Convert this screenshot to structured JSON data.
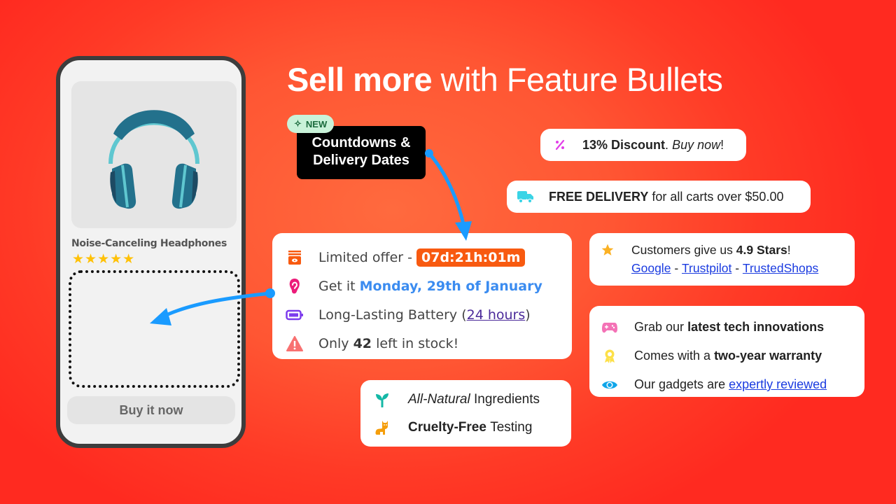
{
  "headline": {
    "bold": "Sell more",
    "light": "with Feature Bullets"
  },
  "phone": {
    "product_title": "Noise-Canceling Headphones",
    "rating_stars": 5,
    "stars_text": "★★★★★",
    "buy_button": "Buy it now",
    "image_icon": "headphones-icon"
  },
  "promo": {
    "badge_label": "NEW",
    "badge_icon": "sparkle-icon",
    "title_line1": "Countdowns &",
    "title_line2": "Delivery Dates"
  },
  "discount_card": {
    "icon": "percent-icon",
    "bold": "13% Discount",
    "sep": ".",
    "italic": "Buy now",
    "end": "!"
  },
  "delivery_card": {
    "icon": "truck-icon",
    "bold": "FREE DELIVERY",
    "rest": "for all carts over $50.00"
  },
  "main_card": {
    "items": [
      {
        "icon": "gift-box-icon",
        "text": "Limited offer -",
        "timer": "07d:21h:01m"
      },
      {
        "icon": "ear-icon",
        "text": "Get it",
        "date": "Monday, 29th of January"
      },
      {
        "icon": "battery-icon",
        "text": "Long-Lasting Battery (",
        "link": "24 hours",
        "end": ")"
      },
      {
        "icon": "warning-icon",
        "pre": "Only",
        "bold": "42",
        "post": "left in stock!"
      }
    ]
  },
  "reviews_card": {
    "icon": "star-icon",
    "text": "Customers give us",
    "bold": "4.9 Stars",
    "end": "!",
    "links": [
      "Google",
      "Trustpilot",
      "TrustedShops"
    ],
    "separator": "-"
  },
  "tech_card": {
    "items": [
      {
        "icon": "gamepad-icon",
        "text": "Grab our",
        "bold": "latest tech innovations"
      },
      {
        "icon": "award-icon",
        "text": "Comes with a",
        "bold": "two-year warranty"
      },
      {
        "icon": "eye-icon",
        "text": "Our gadgets are",
        "link": "expertly reviewed"
      }
    ]
  },
  "natural_card": {
    "items": [
      {
        "icon": "sprout-icon",
        "italic": "All-Natural",
        "rest": "Ingredients"
      },
      {
        "icon": "cat-icon",
        "bold": "Cruelty-Free",
        "rest": "Testing"
      }
    ]
  },
  "colors": {
    "background_center": "#ff6a3e",
    "background_edge": "#ff2a20",
    "timer_bg": "#f85a10",
    "date_blue": "#3b8cf0",
    "arrow_blue": "#1a9bff",
    "link_blue": "#1a3be0",
    "star_yellow": "#ffc107"
  }
}
